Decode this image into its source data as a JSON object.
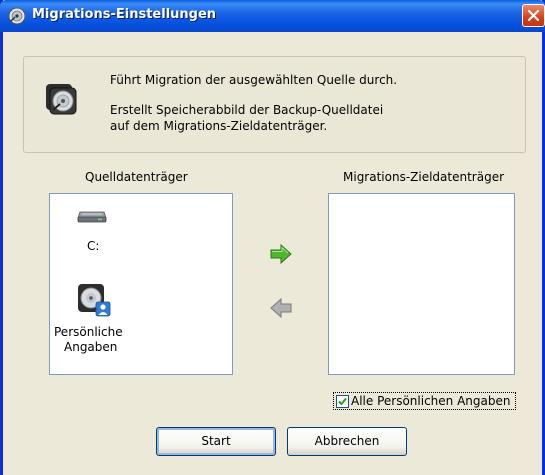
{
  "window": {
    "title": "Migrations-Einstellungen",
    "icon": "disk-settings-icon"
  },
  "info": {
    "line1": "Führt Migration der ausgewählten Quelle durch.",
    "line2": "Erstellt Speicherabbild der Backup-Quelldatei",
    "line3": "auf dem Migrations-Zieldatenträger.",
    "icon": "disk-icon"
  },
  "source": {
    "label": "Quelldatenträger",
    "items": [
      {
        "label": "C:",
        "icon": "hard-drive-icon"
      },
      {
        "label_line1": "Persönliche",
        "label_line2": "Angaben",
        "icon": "personal-disk-icon"
      }
    ]
  },
  "target": {
    "label": "Migrations-Zieldatenträger",
    "items": []
  },
  "arrows": {
    "add": "arrow-right-icon",
    "remove": "arrow-left-icon"
  },
  "options": {
    "all_personal_label": "Alle Persönlichen Angaben",
    "all_personal_checked": true
  },
  "buttons": {
    "start": "Start",
    "cancel": "Abbrechen"
  },
  "colors": {
    "titlebar": "#0a5ee3",
    "window_bg": "#ece9d8",
    "close": "#d6401c",
    "arrow_active": "#4caf2a",
    "arrow_inactive": "#a8a8a8"
  }
}
